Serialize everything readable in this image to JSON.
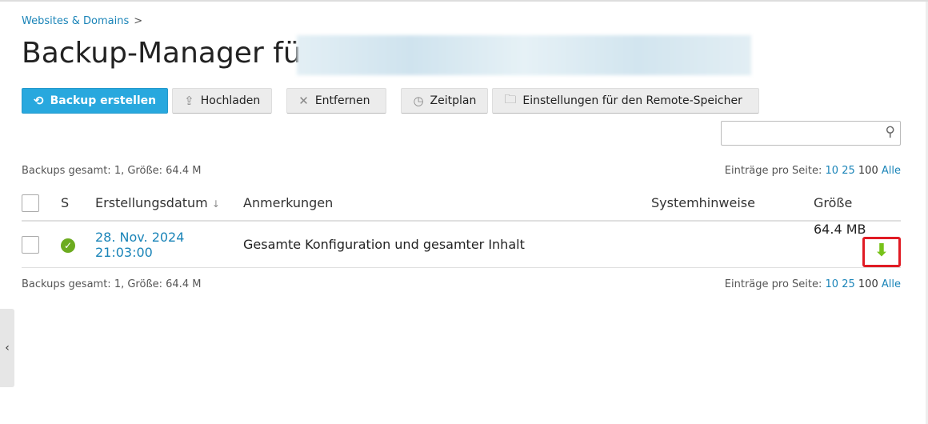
{
  "breadcrumb": {
    "item": "Websites & Domains",
    "sep": ">"
  },
  "title": "Backup-Manager für",
  "toolbar": {
    "create": "Backup erstellen",
    "upload": "Hochladen",
    "remove": "Entfernen",
    "schedule": "Zeitplan",
    "remote": "Einstellungen für den Remote-Speicher"
  },
  "summary": "Backups gesamt: 1, Größe: 64.4 M",
  "per_page": {
    "label": "Einträge pro Seite:",
    "options": [
      "10",
      "25",
      "100",
      "Alle"
    ]
  },
  "columns": {
    "s": "S",
    "date": "Erstellungsdatum",
    "sort": "↓",
    "notes": "Anmerkungen",
    "sys": "Systemhinweise",
    "size": "Größe"
  },
  "rows": [
    {
      "date": "28. Nov. 2024 21:03:00",
      "notes": "Gesamte Konfiguration und gesamter Inhalt",
      "sys": "",
      "size": "64.4 MB"
    }
  ]
}
